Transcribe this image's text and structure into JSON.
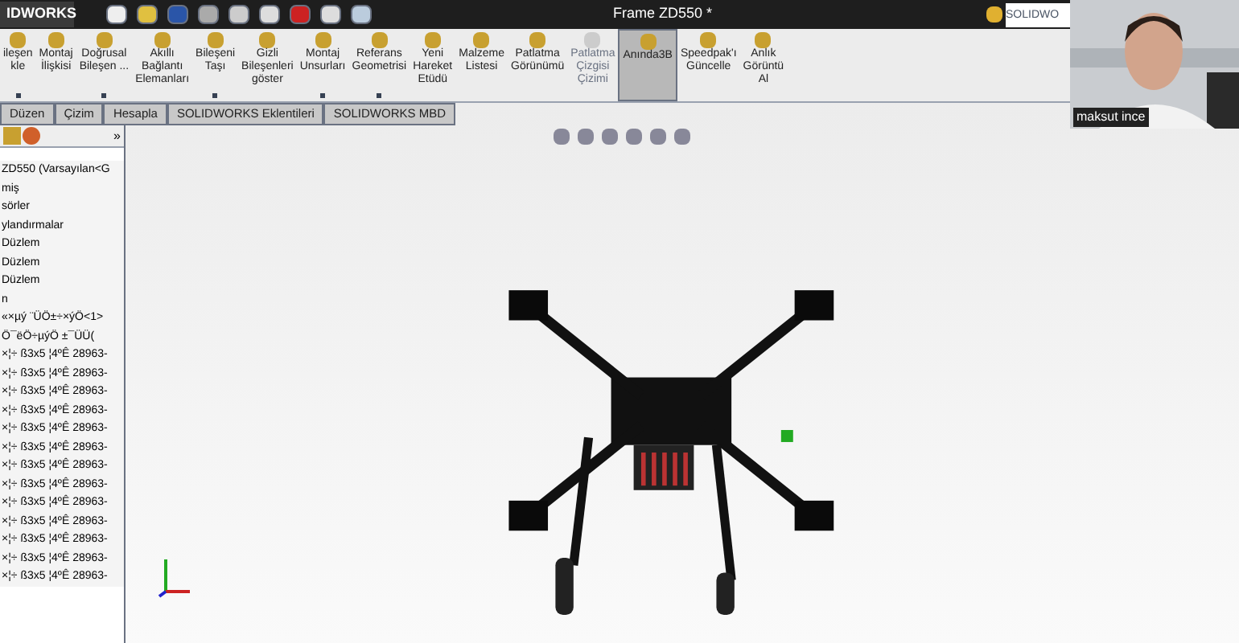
{
  "app_menu": {
    "label": "IDWORKS"
  },
  "window": {
    "title": "Frame ZD550 *"
  },
  "search": {
    "placeholder": "SOLIDWO"
  },
  "ribbon": [
    {
      "lines": [
        "ileşen",
        "kle"
      ],
      "dropdown": true,
      "disabled": false,
      "selected": false
    },
    {
      "lines": [
        "Montaj",
        "İlişkisi"
      ],
      "dropdown": false,
      "disabled": false,
      "selected": false
    },
    {
      "lines": [
        "Doğrusal",
        "Bileşen ..."
      ],
      "dropdown": true,
      "disabled": false,
      "selected": false
    },
    {
      "lines": [
        "Akıllı",
        "Bağlantı",
        "Elemanları"
      ],
      "dropdown": false,
      "disabled": false,
      "selected": false
    },
    {
      "lines": [
        "Bileşeni",
        "Taşı"
      ],
      "dropdown": true,
      "disabled": false,
      "selected": false
    },
    {
      "lines": [
        "Gizli",
        "Bileşenleri",
        "göster"
      ],
      "dropdown": false,
      "disabled": false,
      "selected": false
    },
    {
      "lines": [
        "Montaj",
        "Unsurları"
      ],
      "dropdown": true,
      "disabled": false,
      "selected": false
    },
    {
      "lines": [
        "Referans",
        "Geometrisi"
      ],
      "dropdown": true,
      "disabled": false,
      "selected": false
    },
    {
      "lines": [
        "Yeni",
        "Hareket",
        "Etüdü"
      ],
      "dropdown": false,
      "disabled": false,
      "selected": false
    },
    {
      "lines": [
        "Malzeme",
        "Listesi"
      ],
      "dropdown": false,
      "disabled": false,
      "selected": false
    },
    {
      "lines": [
        "Patlatma",
        "Görünümü"
      ],
      "dropdown": false,
      "disabled": false,
      "selected": false
    },
    {
      "lines": [
        "Patlatma",
        "Çizgisi",
        "Çizimi"
      ],
      "dropdown": false,
      "disabled": true,
      "selected": false
    },
    {
      "lines": [
        "Anında3B"
      ],
      "dropdown": false,
      "disabled": false,
      "selected": true
    },
    {
      "lines": [
        "Speedpak'ı",
        "Güncelle"
      ],
      "dropdown": false,
      "disabled": false,
      "selected": false
    },
    {
      "lines": [
        "Anlık",
        "Görüntü",
        "Al"
      ],
      "dropdown": false,
      "disabled": false,
      "selected": false
    }
  ],
  "tabs": [
    {
      "label": "Düzen",
      "selected": false
    },
    {
      "label": "Çizim",
      "selected": false
    },
    {
      "label": "Hesapla",
      "selected": false
    },
    {
      "label": "SOLIDWORKS Eklentileri",
      "selected": false
    },
    {
      "label": "SOLIDWORKS MBD",
      "selected": false
    }
  ],
  "panel": {
    "collapse": "»"
  },
  "tree": [
    "ZD550  (Varsayılan<G",
    "miş",
    "sörler",
    "ylandırmalar",
    "Düzlem",
    "Düzlem",
    "Düzlem",
    "n",
    "«×µý ¨ÜÖ±÷×ýÖ<1>",
    "Ö¯ëÖ÷µýÖ ±¯ÜÜ(",
    "×¦÷ ß3x5 ¦4ºÊ 28963-",
    "×¦÷ ß3x5 ¦4ºÊ 28963-",
    "×¦÷ ß3x5 ¦4ºÊ 28963-",
    "×¦÷ ß3x5 ¦4ºÊ 28963-",
    "×¦÷ ß3x5 ¦4ºÊ 28963-",
    "×¦÷ ß3x5 ¦4ºÊ 28963-",
    "×¦÷ ß3x5 ¦4ºÊ 28963-",
    "×¦÷ ß3x5 ¦4ºÊ 28963-",
    "×¦÷ ß3x5 ¦4ºÊ 28963-",
    "×¦÷ ß3x5 ¦4ºÊ 28963-",
    "×¦÷ ß3x5 ¦4ºÊ 28963-",
    "×¦÷ ß3x5 ¦4ºÊ 28963-",
    "×¦÷ ß3x5 ¦4ºÊ 28963-"
  ],
  "webcam": {
    "kind": "picture",
    "caption": "maksut ince"
  }
}
